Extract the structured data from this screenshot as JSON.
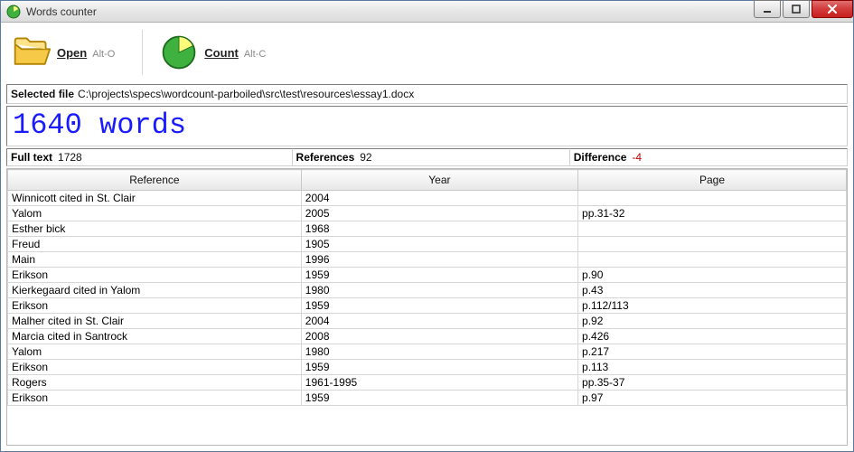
{
  "window": {
    "title": "Words counter"
  },
  "toolbar": {
    "open": {
      "label": "Open",
      "hint": "Alt-O"
    },
    "count": {
      "label": "Count",
      "hint": "Alt-C"
    }
  },
  "selected_file": {
    "label": "Selected file",
    "path": "C:\\projects\\specs\\wordcount-parboiled\\src\\test\\resources\\essay1.docx"
  },
  "headline": "1640 words",
  "stats": {
    "full_text": {
      "label": "Full text",
      "value": "1728"
    },
    "references": {
      "label": "References",
      "value": "92"
    },
    "difference": {
      "label": "Difference",
      "value": "-4"
    }
  },
  "table": {
    "columns": [
      "Reference",
      "Year",
      "Page"
    ],
    "rows": [
      {
        "reference": "Winnicott cited in St. Clair",
        "year": "2004",
        "page": ""
      },
      {
        "reference": "Yalom",
        "year": "2005",
        "page": "pp.31-32"
      },
      {
        "reference": "Esther bick",
        "year": "1968",
        "page": ""
      },
      {
        "reference": "Freud",
        "year": "1905",
        "page": ""
      },
      {
        "reference": "Main",
        "year": "1996",
        "page": ""
      },
      {
        "reference": "Erikson",
        "year": "1959",
        "page": "p.90"
      },
      {
        "reference": "Kierkegaard cited in Yalom",
        "year": "1980",
        "page": "p.43"
      },
      {
        "reference": "Erikson",
        "year": "1959",
        "page": "p.112/113"
      },
      {
        "reference": "Malher cited in St. Clair",
        "year": "2004",
        "page": "p.92"
      },
      {
        "reference": "Marcia cited in Santrock",
        "year": "2008",
        "page": "p.426"
      },
      {
        "reference": "Yalom",
        "year": "1980",
        "page": "p.217"
      },
      {
        "reference": "Erikson",
        "year": "1959",
        "page": "p.113"
      },
      {
        "reference": "Rogers",
        "year": "1961-1995",
        "page": "pp.35-37"
      },
      {
        "reference": "Erikson",
        "year": "1959",
        "page": "p.97"
      }
    ]
  }
}
